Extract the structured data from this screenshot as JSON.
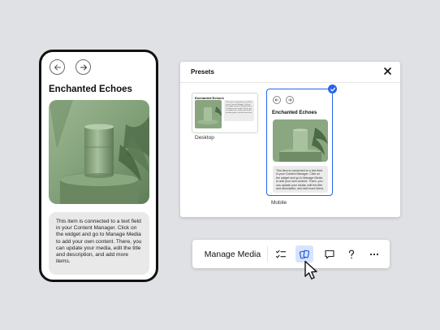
{
  "phone": {
    "title": "Enchanted Echoes",
    "description": "This item is connected to a text field in your Content Manager. Click on the widget and go to Manage Media to add your own content. There, you can update your media, edit the title and description, and add more items.",
    "prev_icon": "arrow-left-icon",
    "next_icon": "arrow-right-icon"
  },
  "presets": {
    "title": "Presets",
    "close_icon": "close-icon",
    "desktop": {
      "label": "Desktop"
    },
    "mobile": {
      "label": "Mobile",
      "title": "Enchanted Echoes",
      "description": "This item is connected to a text field in your Content Manager. Click on the widget and go to Manage Media to add your own content. There, you can update your media, edit the title and description, and add more items.",
      "selected": true
    }
  },
  "toolbar": {
    "manage_label": "Manage Media",
    "buttons": [
      {
        "icon": "checklist-icon"
      },
      {
        "icon": "presets-icon",
        "active": true
      },
      {
        "icon": "comment-icon"
      },
      {
        "icon": "help-icon"
      },
      {
        "icon": "more-icon"
      }
    ]
  },
  "colors": {
    "accent": "#2563eb",
    "active_bg": "#d6e4ff",
    "background": "#dfe1e5",
    "image_green": "#8fae84"
  }
}
